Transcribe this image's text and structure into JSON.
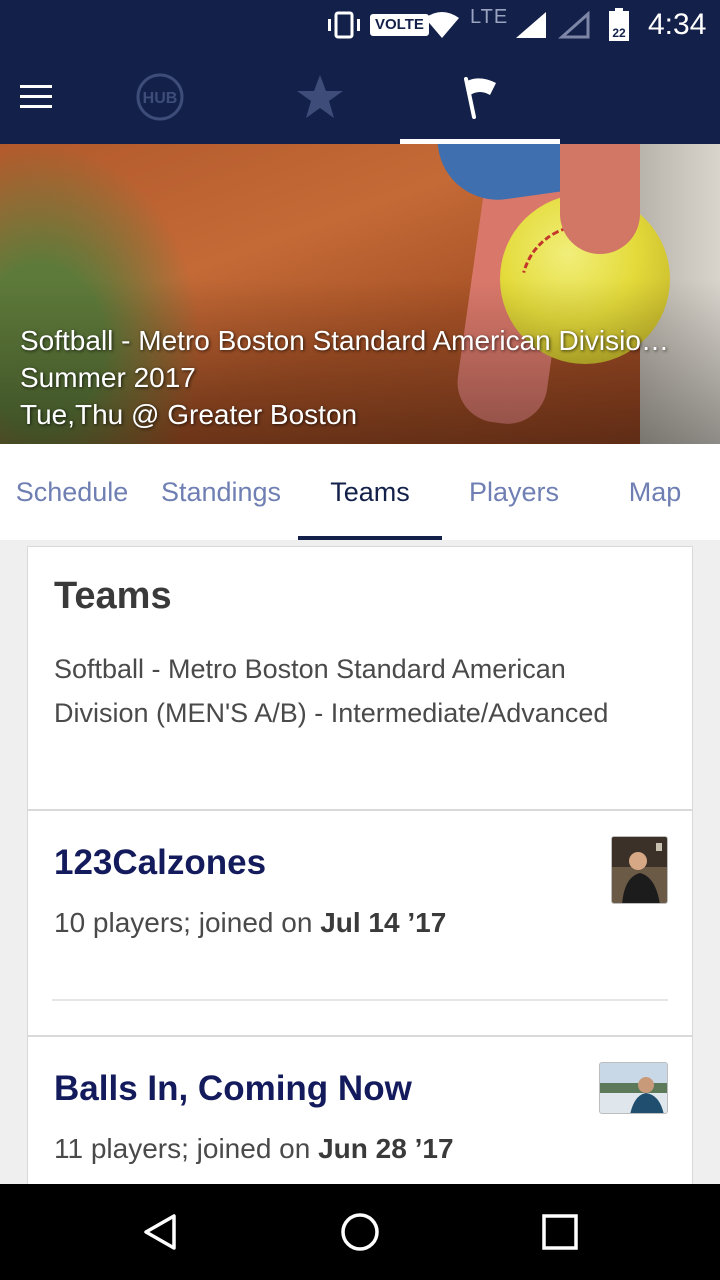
{
  "status_bar": {
    "network_badge": "VOLTE",
    "network_type": "LTE",
    "battery_level": "22",
    "time": "4:34"
  },
  "app_bar": {
    "menu_icon": "hamburger-menu-icon",
    "tabs": [
      {
        "icon": "hub-logo-icon",
        "active": false
      },
      {
        "icon": "star-icon",
        "active": false
      },
      {
        "icon": "flag-icon",
        "active": true
      }
    ]
  },
  "league": {
    "title": "Softball -  Metro Boston Standard American Divisio…",
    "season": "Summer 2017",
    "schedule": "Tue,Thu @ Greater Boston"
  },
  "subtabs": [
    {
      "label": "Schedule",
      "active": false
    },
    {
      "label": "Standings",
      "active": false
    },
    {
      "label": "Teams",
      "active": true
    },
    {
      "label": "Players",
      "active": false
    },
    {
      "label": "Map",
      "active": false
    }
  ],
  "teams_header": {
    "title": "Teams",
    "description": "Softball - Metro Boston Standard American Division (MEN'S A/B) - Intermediate/Advanced"
  },
  "teams": [
    {
      "name": "123Calzones",
      "meta_prefix": "10 players; joined on ",
      "joined": "Jul 14 ’17"
    },
    {
      "name": "Balls In, Coming Now",
      "meta_prefix": "11 players; joined on ",
      "joined": "Jun 28 ’17"
    }
  ],
  "colors": {
    "primary": "#13204a",
    "tab_inactive": "#6f7fb3",
    "team_name": "#131b5c"
  },
  "nav_bar": {
    "back": "back-triangle-icon",
    "home": "home-circle-icon",
    "recents": "recents-square-icon"
  }
}
